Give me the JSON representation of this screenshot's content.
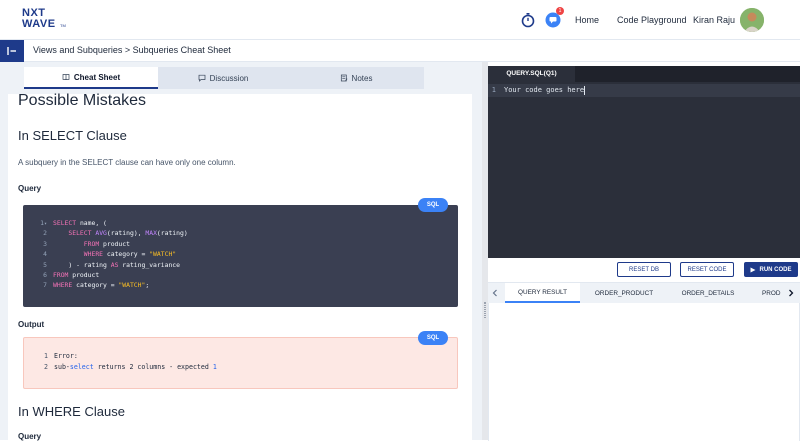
{
  "header": {
    "logo_line1": "NXT",
    "logo_line2": "WAVE",
    "logo_tm": "TM",
    "chat_badge_count": "1",
    "nav": {
      "home": "Home",
      "code_playground": "Code Playground",
      "user_name": "Kiran Raju"
    }
  },
  "breadcrumb": "Views and Subqueries > Subqueries Cheat Sheet",
  "left_tabs": {
    "cheat_sheet": "Cheat Sheet",
    "discussion": "Discussion",
    "notes": "Notes"
  },
  "content": {
    "heading_mistakes": "Possible Mistakes",
    "heading_select": "In SELECT Clause",
    "select_description": "A subquery in the SELECT clause can have only one column.",
    "query_label": "Query",
    "output_label": "Output",
    "sql_badge": "SQL",
    "heading_where": "In WHERE Clause",
    "query_label_2": "Query",
    "code_lines": [
      {
        "n": "1",
        "fold": "▾"
      },
      {
        "n": "2"
      },
      {
        "n": "3"
      },
      {
        "n": "4"
      },
      {
        "n": "5"
      },
      {
        "n": "6"
      },
      {
        "n": "7"
      }
    ],
    "code_tokens": {
      "select": "SELECT",
      "name_open": " name, (",
      "avg": "AVG",
      "rating_comma": "(rating), ",
      "max": "MAX",
      "rating_close": "(rating)",
      "from": "FROM",
      "product": " product",
      "where": "WHERE",
      "category_eq": " category = ",
      "watch": "\"WATCH\"",
      "close_minus": ") - rating ",
      "as": "AS",
      "rating_variance": " rating_variance",
      "semicolon": ";"
    },
    "output_lines": {
      "line1_n": "1",
      "line1_text": "Error:",
      "line2_n": "2",
      "line2_pre": "sub-",
      "line2_select": "select",
      "line2_mid": " returns 2 columns - expected ",
      "line2_num": "1"
    }
  },
  "editor": {
    "tab_label": "QUERY.SQL(Q1)",
    "line_number": "1",
    "code": "Your code goes here"
  },
  "actions": {
    "reset_db": "RESET DB",
    "reset_code": "RESET CODE",
    "run_code": "RUN CODE"
  },
  "result_tabs": {
    "query_result": "QUERY RESULT",
    "order_product": "ORDER_PRODUCT",
    "order_details": "ORDER_DETAILS",
    "product": "PROD"
  },
  "colors": {
    "brand": "#1e3a8a",
    "accent": "#3b82f6",
    "code_bg": "#3a3f52",
    "error_bg": "#fde8e4"
  }
}
